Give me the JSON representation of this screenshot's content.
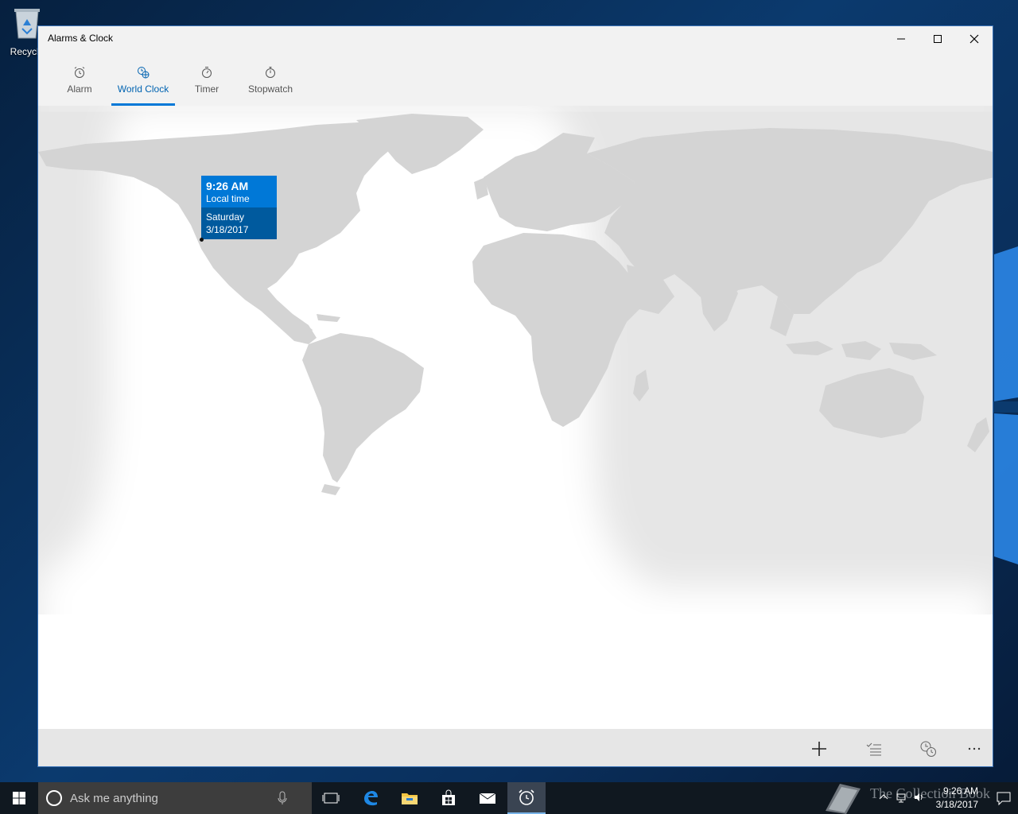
{
  "desktop": {
    "recycle_bin_label": "Recycle"
  },
  "window": {
    "title": "Alarms & Clock"
  },
  "tabs": [
    {
      "label": "Alarm",
      "icon": "alarm-clock-icon"
    },
    {
      "label": "World Clock",
      "icon": "world-clock-icon",
      "active": true
    },
    {
      "label": "Timer",
      "icon": "timer-icon"
    },
    {
      "label": "Stopwatch",
      "icon": "stopwatch-icon"
    }
  ],
  "local_time_card": {
    "time": "9:26 AM",
    "label": "Local time",
    "day": "Saturday",
    "date": "3/18/2017"
  },
  "command_bar": {
    "icons": [
      "add-icon",
      "select-list-icon",
      "compare-clocks-icon",
      "more-icon"
    ]
  },
  "taskbar": {
    "search_placeholder": "Ask me anything",
    "clock_time": "9:26 AM",
    "clock_date": "3/18/2017",
    "watermark": "The Collection Book"
  },
  "colors": {
    "accent": "#0078d7",
    "accent_dark": "#005a9e",
    "map_land": "#d4d4d4",
    "map_night": "#e6e6e6",
    "map_day": "#ffffff"
  }
}
